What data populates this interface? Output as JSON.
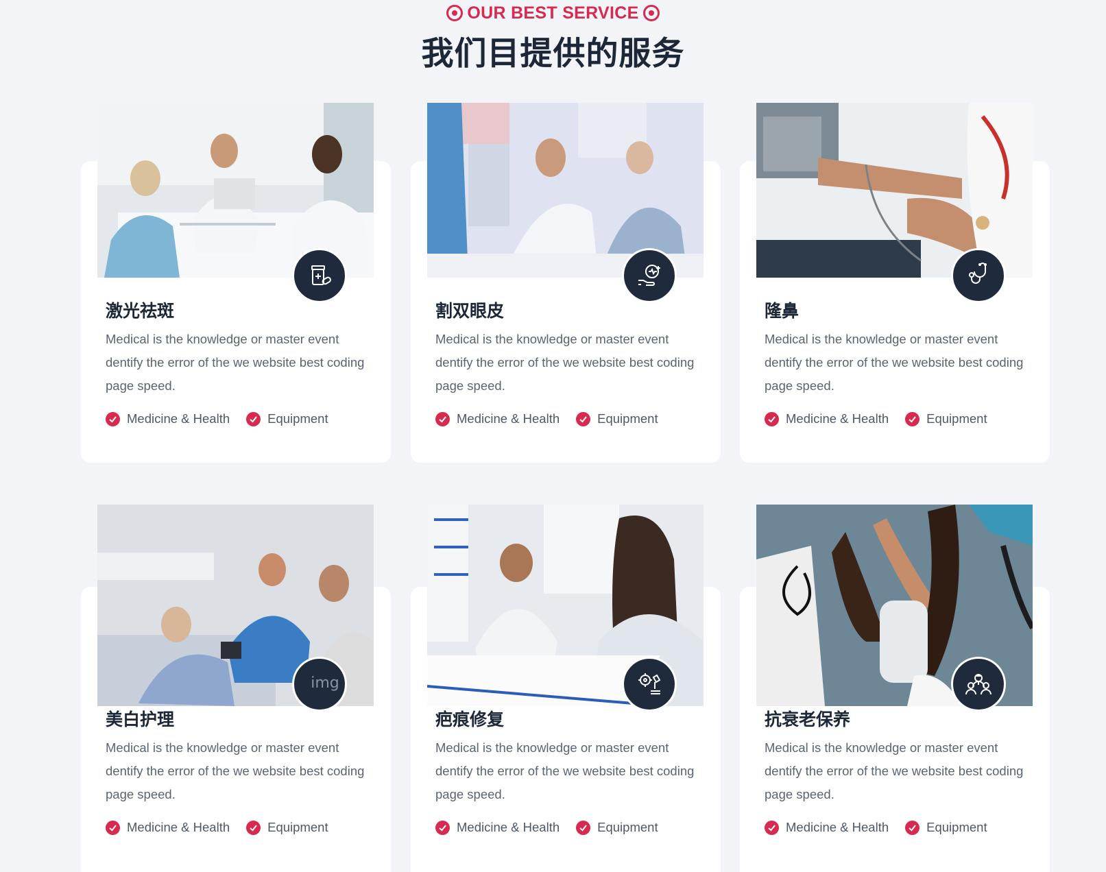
{
  "header": {
    "subtitle": "OUR BEST SERVICE",
    "title": "我们目提供的服务",
    "accent_color": "#d8294f"
  },
  "services": [
    {
      "title": "激光祛斑",
      "description": "Medical is the knowledge or master event dentify the error of the we website best coding page speed.",
      "icon": "medicine-bottle-icon",
      "image_alt": "doctors meeting at table with laptop",
      "tags": [
        "Medicine & Health",
        "Equipment"
      ]
    },
    {
      "title": "割双眼皮",
      "description": "Medical is the knowledge or master event dentify the error of the we website best coding page speed.",
      "icon": "hand-heart-care-icon",
      "image_alt": "doctor examining elderly patient with stethoscope",
      "tags": [
        "Medicine & Health",
        "Equipment"
      ]
    },
    {
      "title": "隆鼻",
      "description": "Medical is the knowledge or master event dentify the error of the we website best coding page speed.",
      "icon": "stethoscope-icon",
      "image_alt": "blood pressure measurement on arm",
      "tags": [
        "Medicine & Health",
        "Equipment"
      ]
    },
    {
      "title": "美白护理",
      "description": "Medical is the knowledge or master event dentify the error of the we website best coding page speed.",
      "icon": "broken-image-icon",
      "icon_text": "img",
      "image_alt": "nurse checking patient in hospital bed",
      "tags": [
        "Medicine & Health",
        "Equipment"
      ]
    },
    {
      "title": "疤痕修复",
      "description": "Medical is the knowledge or master event dentify the error of the we website best coding page speed.",
      "icon": "microscope-icon",
      "image_alt": "doctor in mask talking with patient at desk",
      "tags": [
        "Medicine & Health",
        "Equipment"
      ]
    },
    {
      "title": "抗衰老保养",
      "description": "Medical is the knowledge or master event dentify the error of the we website best coding page speed.",
      "icon": "medical-team-icon",
      "image_alt": "blood pressure cuff on arm with stethoscope",
      "tags": [
        "Medicine & Health",
        "Equipment"
      ]
    }
  ]
}
